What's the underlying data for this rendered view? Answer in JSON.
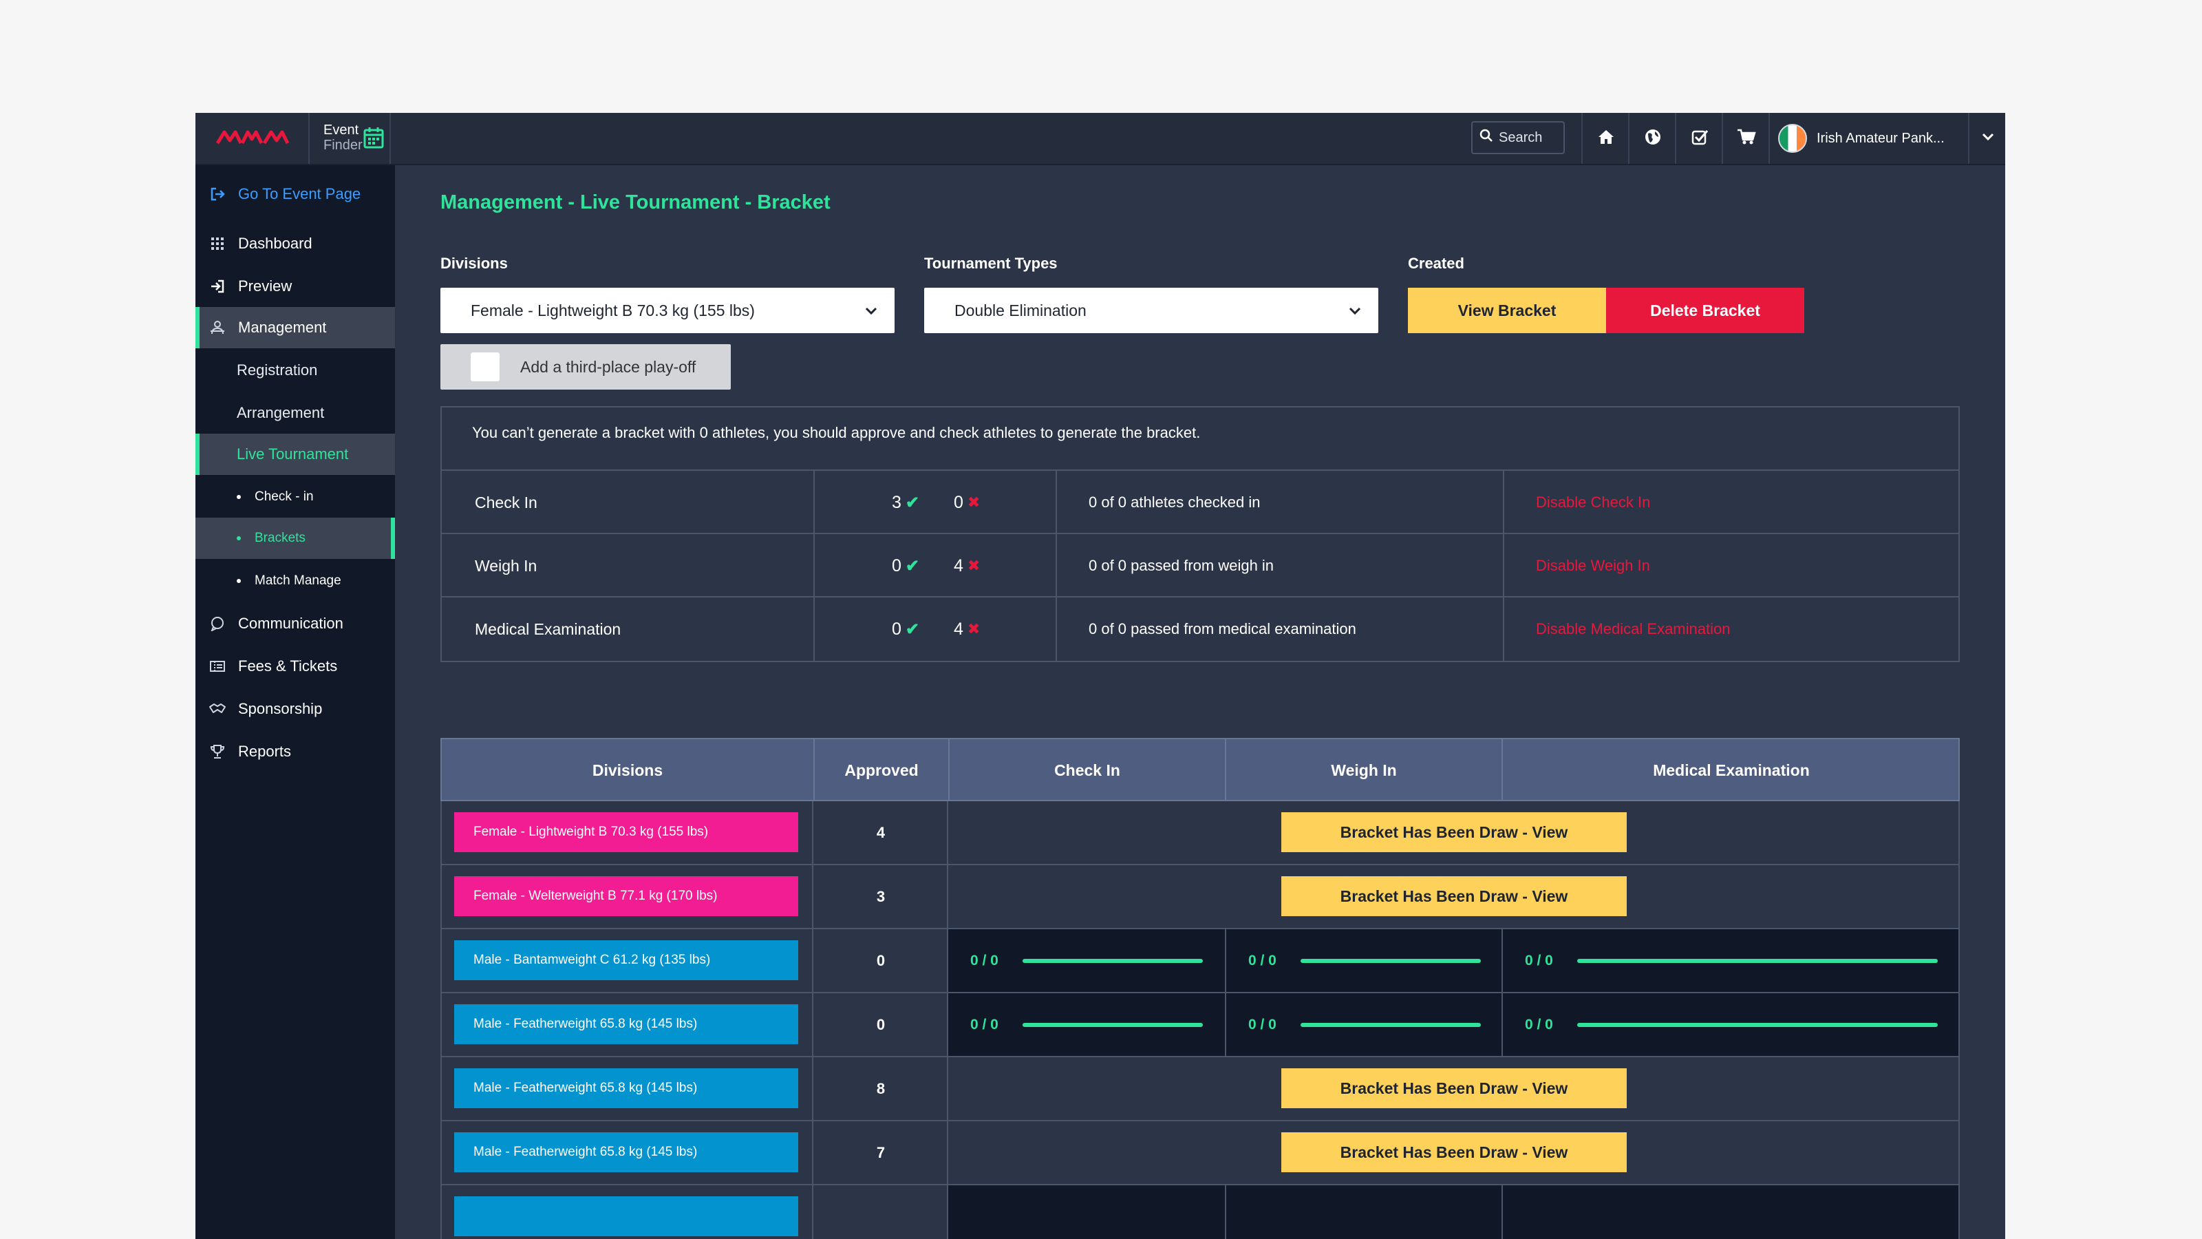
{
  "topbar": {
    "brand": "MAM",
    "event_finder_line1": "Event",
    "event_finder_line2": "Finder",
    "search_label": "Search",
    "user_name": "Irish Amateur Pank..."
  },
  "sidebar": {
    "go_to_event": "Go To Event Page",
    "items": [
      {
        "label": "Dashboard"
      },
      {
        "label": "Preview"
      },
      {
        "label": "Management"
      },
      {
        "label": "Registration"
      },
      {
        "label": "Arrangement"
      },
      {
        "label": "Live Tournament"
      },
      {
        "label": "Check - in"
      },
      {
        "label": "Brackets"
      },
      {
        "label": "Match Manage"
      },
      {
        "label": "Communication"
      },
      {
        "label": "Fees & Tickets"
      },
      {
        "label": "Sponsorship"
      },
      {
        "label": "Reports"
      }
    ]
  },
  "page": {
    "title": "Management - Live Tournament - Bracket",
    "divisions_label": "Divisions",
    "divisions_value": "Female - Lightweight B 70.3 kg (155 lbs)",
    "types_label": "Tournament Types",
    "types_value": "Double Elimination",
    "created_label": "Created",
    "view_bracket": "View Bracket",
    "delete_bracket": "Delete Bracket",
    "third_place": "Add a third-place play-off"
  },
  "info": {
    "message": "You can’t generate a bracket with 0 athletes, you should approve and check athletes to generate the bracket.",
    "rows": [
      {
        "label": "Check In",
        "ok": "3",
        "no": "0",
        "status": "0 of 0 athletes checked in",
        "action": "Disable Check In"
      },
      {
        "label": "Weigh In",
        "ok": "0",
        "no": "4",
        "status": "0 of 0 passed from weigh in",
        "action": "Disable Weigh In"
      },
      {
        "label": "Medical Examination",
        "ok": "0",
        "no": "4",
        "status": "0 of 0 passed from medical examination",
        "action": "Disable Medical Examination"
      }
    ]
  },
  "table": {
    "headers": [
      "Divisions",
      "Approved",
      "Check In",
      "Weigh In",
      "Medical Examination"
    ],
    "rows": [
      {
        "division": "Female - Lightweight B 70.3 kg (155 lbs)",
        "approved": "4",
        "action": "Bracket Has Been Draw - View"
      },
      {
        "division": "Female - Welterweight B 77.1 kg (170 lbs)",
        "approved": "3",
        "action": "Bracket Has Been Draw - View"
      },
      {
        "division": "Male - Bantamweight C 61.2 kg (135 lbs)",
        "approved": "0",
        "check_in": "0 / 0",
        "weigh_in": "0 / 0",
        "medical": "0 / 0"
      },
      {
        "division": "Male - Featherweight 65.8 kg (145 lbs)",
        "approved": "0",
        "check_in": "0 / 0",
        "weigh_in": "0 / 0",
        "medical": "0 / 0"
      },
      {
        "division": "Male - Featherweight 65.8 kg (145 lbs)",
        "approved": "8",
        "action": "Bracket Has Been Draw - View"
      },
      {
        "division": "Male - Featherweight 65.8 kg (145 lbs)",
        "approved": "7",
        "action": "Bracket Has Been Draw - View"
      }
    ]
  },
  "colors": {
    "accent_green": "#2fe39b",
    "danger_red": "#e8173c",
    "yellow": "#fdd15a",
    "pink_tag": "#f31d93",
    "blue_tag": "#0393cf"
  }
}
